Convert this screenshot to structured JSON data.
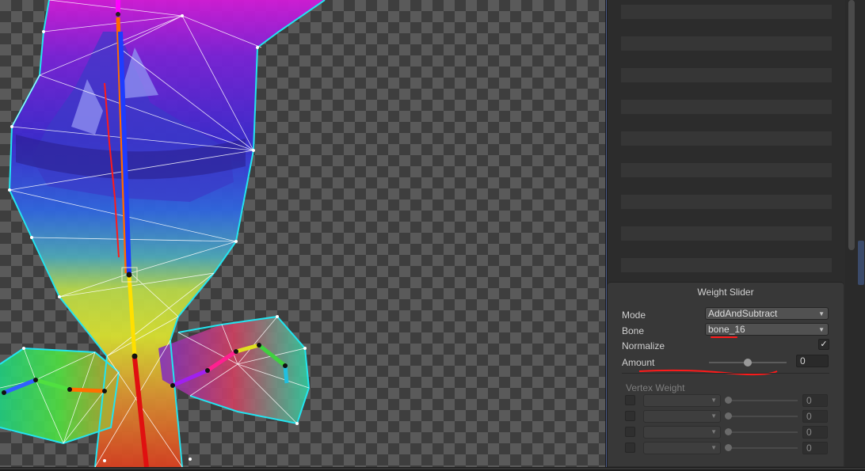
{
  "weight_slider": {
    "title": "Weight Slider",
    "mode": {
      "label": "Mode",
      "value": "AddAndSubtract"
    },
    "bone": {
      "label": "Bone",
      "value": "bone_16"
    },
    "normalize": {
      "label": "Normalize",
      "checked": true,
      "glyph": "✓"
    },
    "amount": {
      "label": "Amount",
      "value": "0",
      "slider_fraction": 0.5
    },
    "vertex_weight": {
      "label": "Vertex Weight",
      "rows": [
        {
          "value": "0"
        },
        {
          "value": "0"
        },
        {
          "value": "0"
        },
        {
          "value": "0"
        }
      ]
    }
  },
  "icons": {
    "dropdown_arrow": "▼",
    "check": "✓"
  },
  "colors": {
    "annotation_red": "#ff1a1a",
    "mesh_outline": "#23e4f0",
    "panel_bg": "#383838"
  }
}
